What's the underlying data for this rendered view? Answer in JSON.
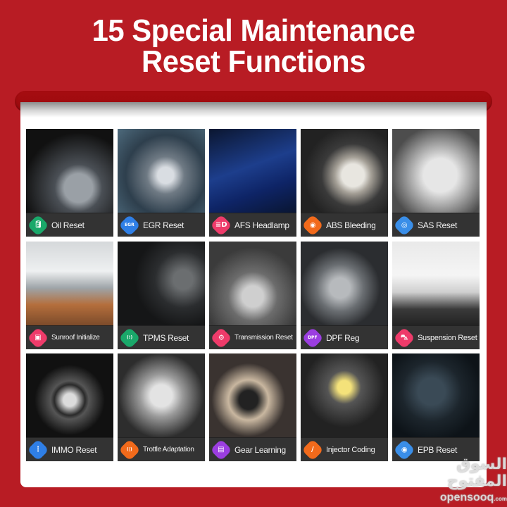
{
  "header": {
    "title_line1": "15 Special Maintenance",
    "title_line2": "Reset Functions"
  },
  "colors": {
    "background_red": "#b81c24",
    "caption_bar": "#333333"
  },
  "functions": [
    {
      "label": "Oil Reset",
      "icon": "oil-can-icon",
      "glyph": "🛢",
      "badge_color": "#1aa86a",
      "photo": "oil-pouring"
    },
    {
      "label": "EGR Reset",
      "icon": "egr-icon",
      "glyph": "EGR",
      "badge_color": "#2f7fe6",
      "photo": "engine-gears"
    },
    {
      "label": "AFS Headlamp",
      "icon": "headlamp-icon",
      "glyph": "≡D",
      "badge_color": "#ee3b6a",
      "photo": "blue-car-headlamp"
    },
    {
      "label": "ABS Bleeding",
      "icon": "abs-icon",
      "glyph": "◉",
      "badge_color": "#f26a1b",
      "photo": "brake-disc"
    },
    {
      "label": "SAS Reset",
      "icon": "steering-sensor-icon",
      "glyph": "◎",
      "badge_color": "#3a8ee8",
      "photo": "airbags"
    },
    {
      "label": "Sunroof Initialize",
      "icon": "sunroof-icon",
      "glyph": "▣",
      "badge_color": "#ee3b6a",
      "photo": "sunroof-interior"
    },
    {
      "label": "TPMS Reset",
      "icon": "tire-pressure-icon",
      "glyph": "(!)",
      "badge_color": "#1aa86a",
      "photo": "wheel-tire"
    },
    {
      "label": "Transmission Reset",
      "icon": "gears-icon",
      "glyph": "⚙",
      "badge_color": "#ee3b6a",
      "photo": "transmission"
    },
    {
      "label": "DPF Reg",
      "icon": "dpf-icon",
      "glyph": "DPF",
      "badge_color": "#9b3ee0",
      "photo": "engine-bay"
    },
    {
      "label": "Suspension Reset",
      "icon": "suspension-icon",
      "glyph": "⛍",
      "badge_color": "#ee3b6a",
      "photo": "car-on-jack"
    },
    {
      "label": "IMMO Reset",
      "icon": "key-fob-icon",
      "glyph": "⋮",
      "badge_color": "#2f7fe6",
      "photo": "start-stop-button"
    },
    {
      "label": "Trottle Adaptation",
      "icon": "throttle-icon",
      "glyph": "(|)",
      "badge_color": "#f26a1b",
      "photo": "throttle-body"
    },
    {
      "label": "Gear Learning",
      "icon": "gear-learning-icon",
      "glyph": "▤",
      "badge_color": "#9b3ee0",
      "photo": "steering-wheel"
    },
    {
      "label": "Injector Coding",
      "icon": "injector-icon",
      "glyph": "/",
      "badge_color": "#f26a1b",
      "photo": "engine-reservoir"
    },
    {
      "label": "EPB Reset",
      "icon": "parking-brake-icon",
      "glyph": "◉",
      "badge_color": "#3a8ee8",
      "photo": "epb-switch"
    }
  ],
  "watermark": {
    "arabic": "السوق المفتوح",
    "latin": "opensooq",
    "suffix": ".com"
  }
}
